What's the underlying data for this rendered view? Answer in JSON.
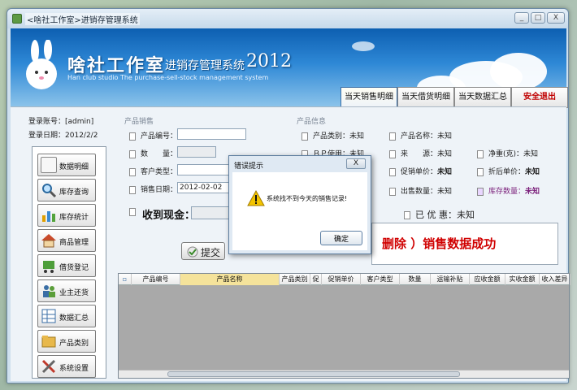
{
  "window": {
    "title": "<啥社工作室>进销存管理系统",
    "controls": [
      "_",
      "□",
      "X"
    ]
  },
  "banner": {
    "title": "啥社工作室",
    "subtitle": "进销存管理系统",
    "year": "2012",
    "english": "Han club studio The purchase-sell-stock management system"
  },
  "topnav": {
    "items": [
      {
        "label": "当天销售明细"
      },
      {
        "label": "当天借货明细"
      },
      {
        "label": "当天数据汇总"
      },
      {
        "label": "安全退出"
      }
    ]
  },
  "login": {
    "account_label": "登录账号：",
    "account_value": "[admin]",
    "date_label": "登录日期：",
    "date_value": "2012/2/2"
  },
  "sidebar": {
    "items": [
      {
        "label": "数据明细",
        "icon": "list-icon"
      },
      {
        "label": "库存查询",
        "icon": "search-icon"
      },
      {
        "label": "库存统计",
        "icon": "bar-chart-icon"
      },
      {
        "label": "商品管理",
        "icon": "house-icon"
      },
      {
        "label": "借货登记",
        "icon": "cart-icon"
      },
      {
        "label": "业主还货",
        "icon": "people-icon"
      },
      {
        "label": "数据汇总",
        "icon": "grid-icon"
      },
      {
        "label": "产品类别",
        "icon": "folder-icon"
      },
      {
        "label": "系统设置",
        "icon": "tools-icon"
      }
    ]
  },
  "sale": {
    "group_label": "产品销售",
    "product_code_label": "产品编号：",
    "quantity_label": "数　　量：",
    "customer_type_label": "客户类型：",
    "sale_date_label": "销售日期：",
    "sale_date_value": "2012-02-02",
    "cash_label": "收到现金：",
    "submit_label": "提交"
  },
  "info": {
    "group_label": "产品信息",
    "category_label": "产品类别：",
    "category_value": "未知",
    "name_label": "产品名称：",
    "name_value": "未知",
    "usage_label": "ＢＰ使用：",
    "usage_value": "未知",
    "source_label": "来　　源：",
    "source_value": "未知",
    "net_weight_label": "净重(克)：",
    "net_weight_value": "未知",
    "promo_price_label": "促销单价：",
    "promo_price_value": "未知",
    "discount_price_label": "折后单价：",
    "discount_price_value": "未知",
    "sold_qty_label": "出售数量：",
    "sold_qty_value": "未知",
    "stock_qty_label": "库存数量：",
    "stock_qty_value": "未知",
    "already_discount_label": "已 优 惠：",
    "already_discount_value": "未知"
  },
  "status": {
    "message": "删除 ）销售数据成功"
  },
  "grid": {
    "columns": [
      "产品编号",
      "产品名称",
      "产品类别",
      "促",
      "促销单价",
      "客户类型",
      "数量",
      "运输补贴",
      "应收金额",
      "实收金额",
      "收入差异"
    ],
    "scroll_marker": "▫"
  },
  "dialog": {
    "title": "错误提示",
    "message": "系统找不到今天的销售记录!",
    "ok_label": "确定",
    "close_label": "X"
  },
  "colors": {
    "accent": "#2e88d6",
    "danger": "#d00000",
    "header_selected": "#f5e39b"
  }
}
